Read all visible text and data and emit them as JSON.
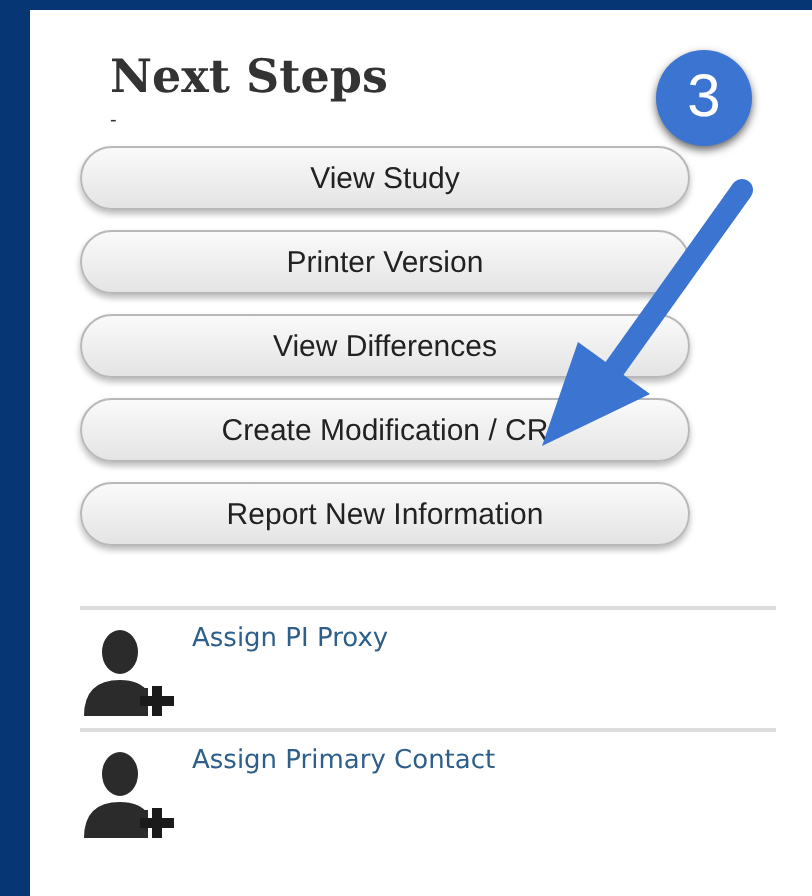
{
  "panel": {
    "title": "Next Steps",
    "subtitle": "-"
  },
  "buttons": [
    {
      "label": "View Study"
    },
    {
      "label": "Printer Version"
    },
    {
      "label": "View Differences"
    },
    {
      "label": "Create Modification / CR"
    },
    {
      "label": "Report New Information"
    }
  ],
  "actions": [
    {
      "label": "Assign PI Proxy"
    },
    {
      "label": "Assign Primary Contact"
    }
  ],
  "callout": {
    "number": "3"
  }
}
